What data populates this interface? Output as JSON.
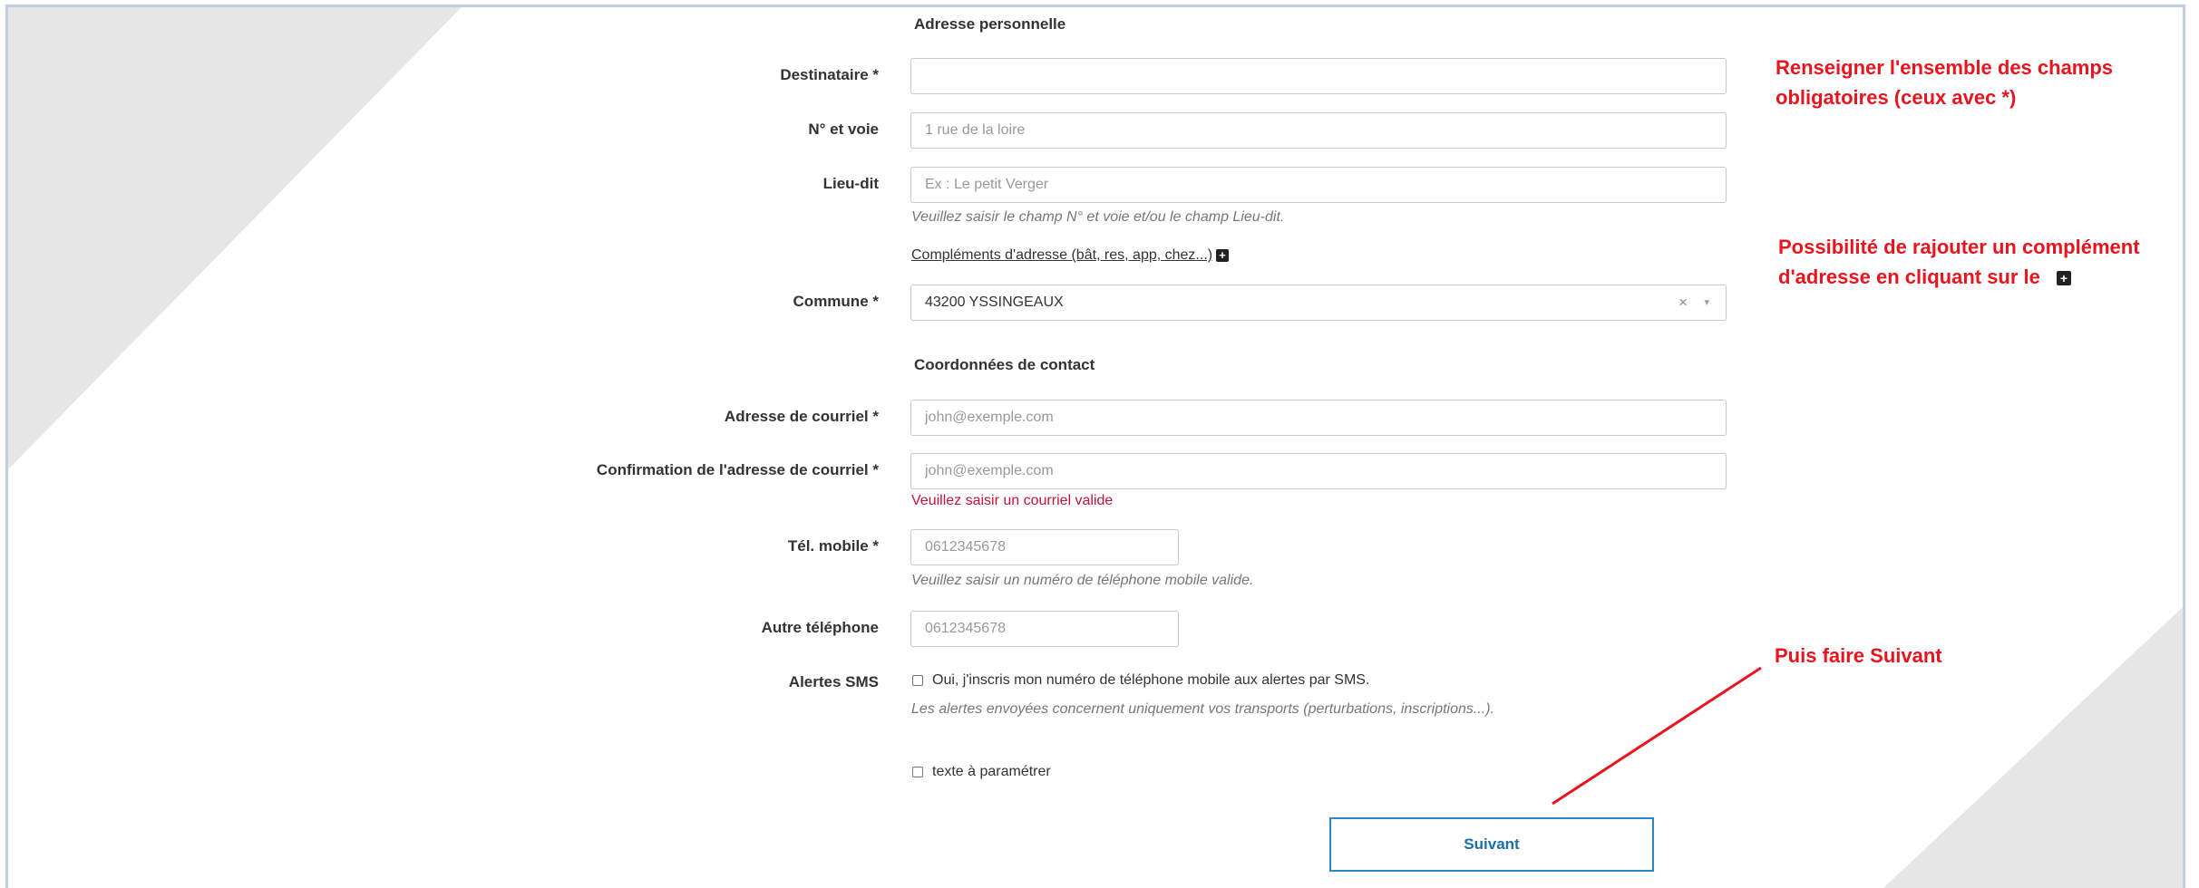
{
  "sections": {
    "personal_address": "Adresse personnelle",
    "contact": "Coordonnées de contact"
  },
  "fields": {
    "recipient": {
      "label": "Destinataire *",
      "value": "",
      "placeholder": ""
    },
    "street": {
      "label": "N° et voie",
      "value": "",
      "placeholder": "1 rue de la loire"
    },
    "locality": {
      "label": "Lieu-dit",
      "value": "",
      "placeholder": "Ex : Le petit Verger",
      "help": "Veuillez saisir le champ N° et voie et/ou le champ Lieu-dit."
    },
    "complement_link": "Compléments d'adresse (bât, res, app, chez...)",
    "commune": {
      "label": "Commune *",
      "value": "43200 YSSINGEAUX",
      "clear": "×",
      "arrow": "▾"
    },
    "email": {
      "label": "Adresse de courriel *",
      "value": "",
      "placeholder": "john@exemple.com"
    },
    "email_confirm": {
      "label": "Confirmation de l'adresse de courriel *",
      "value": "",
      "placeholder": "john@exemple.com",
      "error": "Veuillez saisir un courriel valide"
    },
    "mobile": {
      "label": "Tél. mobile *",
      "value": "",
      "placeholder": "0612345678",
      "help": "Veuillez saisir un numéro de téléphone mobile valide."
    },
    "other_phone": {
      "label": "Autre téléphone",
      "value": "",
      "placeholder": "0612345678"
    },
    "sms": {
      "label": "Alertes SMS",
      "checkbox_label": "Oui, j'inscris mon numéro de téléphone mobile aux alertes par SMS.",
      "checked": false,
      "help": "Les alertes envoyées concernent uniquement vos transports (perturbations, inscriptions...)."
    },
    "custom_text": {
      "checkbox_label": "texte à paramétrer",
      "checked": false
    }
  },
  "next_button": "Suivant",
  "annotations": {
    "note1_line1": "Renseigner l'ensemble des champs",
    "note1_line2": "obligatoires (ceux avec *)",
    "note2_line1": "Possibilité de rajouter un complément",
    "note2_line2": "d'adresse en cliquant sur le",
    "note3": "Puis faire Suivant",
    "color": "#e8141e"
  },
  "icons": {
    "plus": "plus-square-icon"
  }
}
